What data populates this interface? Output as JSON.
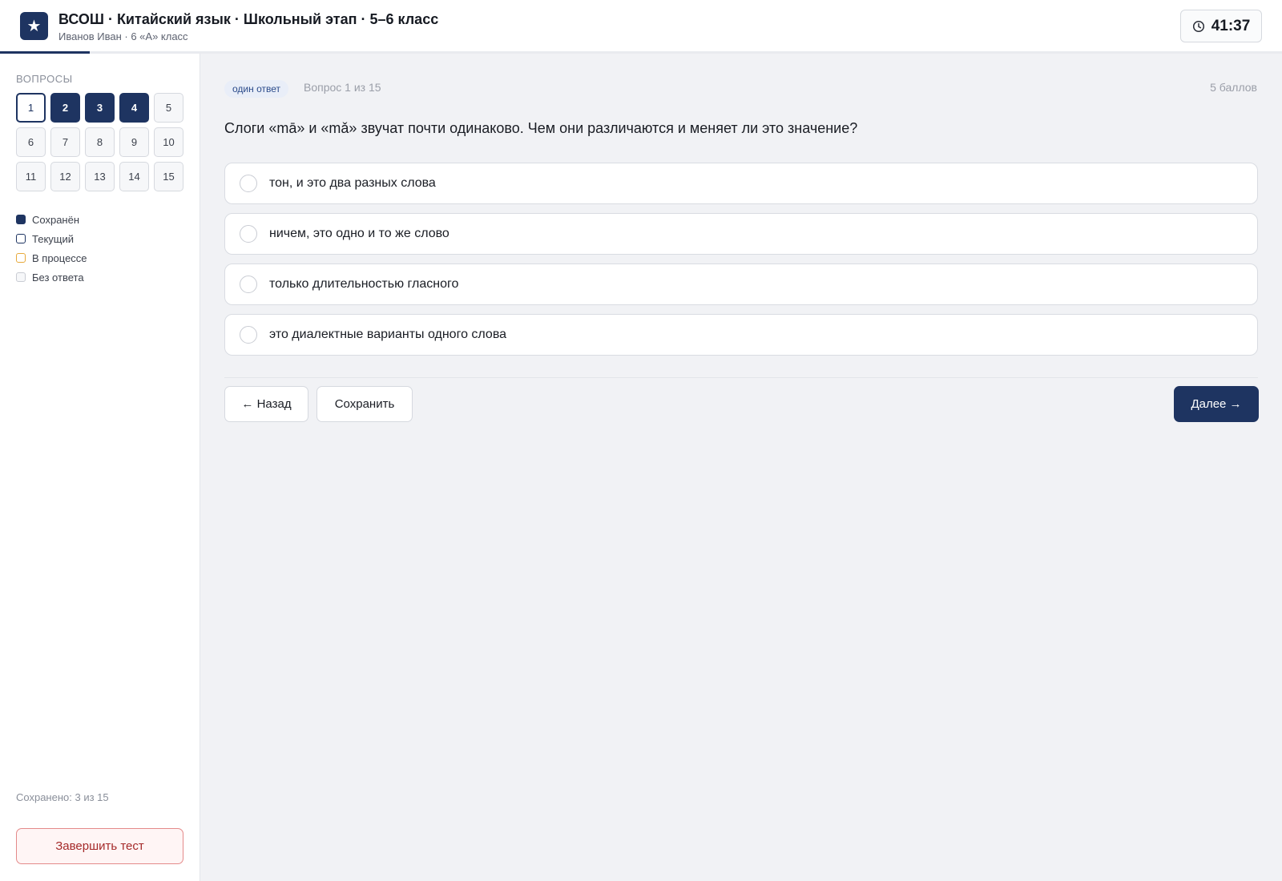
{
  "header": {
    "logo_icon": "star-icon",
    "logo_glyph": "★",
    "title": "ВСОШ · Китайский язык · Школьный этап · 5–6 класс",
    "subtitle": "Иванов Иван · 6 «А» класс",
    "timer_icon": "clock-icon",
    "timer": "41:37",
    "progress_fraction": 0.07
  },
  "sidebar": {
    "heading": "ВОПРОСЫ",
    "questions": [
      {
        "num": "1",
        "state": "current"
      },
      {
        "num": "2",
        "state": "saved"
      },
      {
        "num": "3",
        "state": "saved"
      },
      {
        "num": "4",
        "state": "saved"
      },
      {
        "num": "5",
        "state": "none"
      },
      {
        "num": "6",
        "state": "none"
      },
      {
        "num": "7",
        "state": "none"
      },
      {
        "num": "8",
        "state": "none"
      },
      {
        "num": "9",
        "state": "none"
      },
      {
        "num": "10",
        "state": "none"
      },
      {
        "num": "11",
        "state": "none"
      },
      {
        "num": "12",
        "state": "none"
      },
      {
        "num": "13",
        "state": "none"
      },
      {
        "num": "14",
        "state": "none"
      },
      {
        "num": "15",
        "state": "none"
      }
    ],
    "legend": {
      "saved": "Сохранён",
      "current": "Текущий",
      "in_progress": "В процессе",
      "no_answer": "Без ответа"
    },
    "saved_count": "Сохранено: 3 из 15",
    "finish_label": "Завершить тест"
  },
  "main": {
    "badge": "один ответ",
    "question_number": "Вопрос 1 из 15",
    "points": "5 баллов",
    "question_text": "Слоги «mā» и «mǎ» звучат почти одинаково. Чем они различаются и меняет ли это значение?",
    "options": [
      "тон, и это два разных слова",
      "ничем, это одно и то же слово",
      "только длительностью гласного",
      "это диалектные варианты одного слова"
    ],
    "back_label": "← Назад",
    "save_label": "Сохранить",
    "next_label": "Далее →"
  },
  "colors": {
    "accent": "#1e3461",
    "in_progress": "#e7a93a",
    "danger": "#a52a2a",
    "background": "#f1f2f5"
  }
}
